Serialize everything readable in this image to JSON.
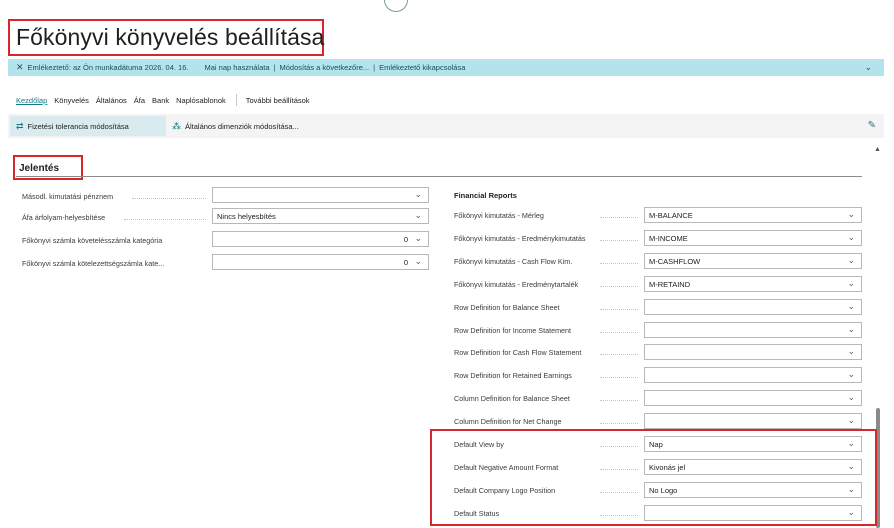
{
  "page": {
    "title": "Főkönyvi könyvelés beállítása"
  },
  "notification": {
    "reminder": "Emlékeztető: az Ön munkadátuma 2026. 04. 16.",
    "use_today": "Mai nap használata",
    "change_next": "Módosítás a következőre...",
    "turn_off": "Emlékeztető kikapcsolása"
  },
  "tabs": [
    "Kezdőlap",
    "Könyvelés",
    "Általános",
    "Áfa",
    "Bank",
    "Naplósablonok",
    "További beállítások"
  ],
  "actions": {
    "payment_tolerance": "Fizetési tolerancia módosítása",
    "general_dimensions": "Általános dimenziók módosítása..."
  },
  "section": {
    "title": "Jelentés"
  },
  "left_fields": [
    {
      "label": "Másodl. kimutatási pénznem",
      "value": ""
    },
    {
      "label": "Áfa árfolyam-helyesbítése",
      "value": "Nincs helyesbítés"
    },
    {
      "label": "Főkönyvi számla követelésszámla kategória",
      "value": "0"
    },
    {
      "label": "Főkönyvi számla kötelezettségszámla kate...",
      "value": "0"
    }
  ],
  "financial_reports": {
    "title": "Financial Reports",
    "fields": [
      {
        "label": "Főkönyvi kimutatás - Mérleg",
        "value": "M-BALANCE"
      },
      {
        "label": "Főkönyvi kimutatás - Eredménykimutatás",
        "value": "M-INCOME"
      },
      {
        "label": "Főkönyvi kimutatás - Cash Flow Kim.",
        "value": "M-CASHFLOW"
      },
      {
        "label": "Főkönyvi kimutatás - Eredménytartalék",
        "value": "M-RETAIND"
      },
      {
        "label": "Row Definition for Balance Sheet",
        "value": ""
      },
      {
        "label": "Row Definition for Income Statement",
        "value": ""
      },
      {
        "label": "Row Definition for Cash Flow Statement",
        "value": ""
      },
      {
        "label": "Row Definition for Retained Earnings",
        "value": ""
      },
      {
        "label": "Column Definition for Balance Sheet",
        "value": ""
      },
      {
        "label": "Column Definition for Net Change",
        "value": ""
      },
      {
        "label": "Default View by",
        "value": "Nap"
      },
      {
        "label": "Default Negative Amount Format",
        "value": "Kivonás jel"
      },
      {
        "label": "Default Company Logo Position",
        "value": "No Logo"
      },
      {
        "label": "Default Status",
        "value": ""
      }
    ]
  },
  "icons": {
    "close": "close-icon",
    "chevron_down": "chevron-down-icon",
    "tolerance": "payment-tolerance-icon",
    "dimensions": "dimensions-icon",
    "pin": "pin-icon"
  },
  "colors": {
    "accent": "#0e7b8b",
    "notification_bg": "#b4e4eb",
    "highlight_red": "#d9262b"
  }
}
